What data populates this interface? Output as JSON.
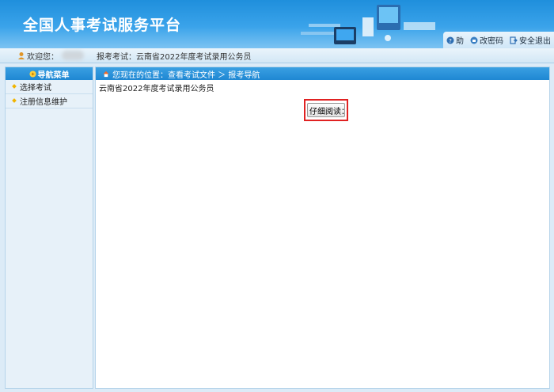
{
  "header": {
    "title": "全国人事考试服务平台",
    "links": [
      {
        "label": "助",
        "icon": "help-icon"
      },
      {
        "label": "改密码",
        "icon": "key-icon"
      },
      {
        "label": "安全退出",
        "icon": "exit-icon"
      }
    ]
  },
  "infobar": {
    "welcome_label": "欢迎您：",
    "exam_label": "报考考试：云南省2022年度考试录用公务员"
  },
  "sidebar": {
    "heading": "导航菜单",
    "items": [
      {
        "label": "选择考试"
      },
      {
        "label": "注册信息维护"
      }
    ]
  },
  "main": {
    "breadcrumb": "您现在的位置：查看考试文件 ＞ 报考导航",
    "exam_name": "云南省2022年度考试录用公务员",
    "read_button": "仔细阅读："
  },
  "colors": {
    "header_blue": "#1f8fdc",
    "bar_blue": "#2590d8",
    "highlight_red": "#e02222"
  }
}
